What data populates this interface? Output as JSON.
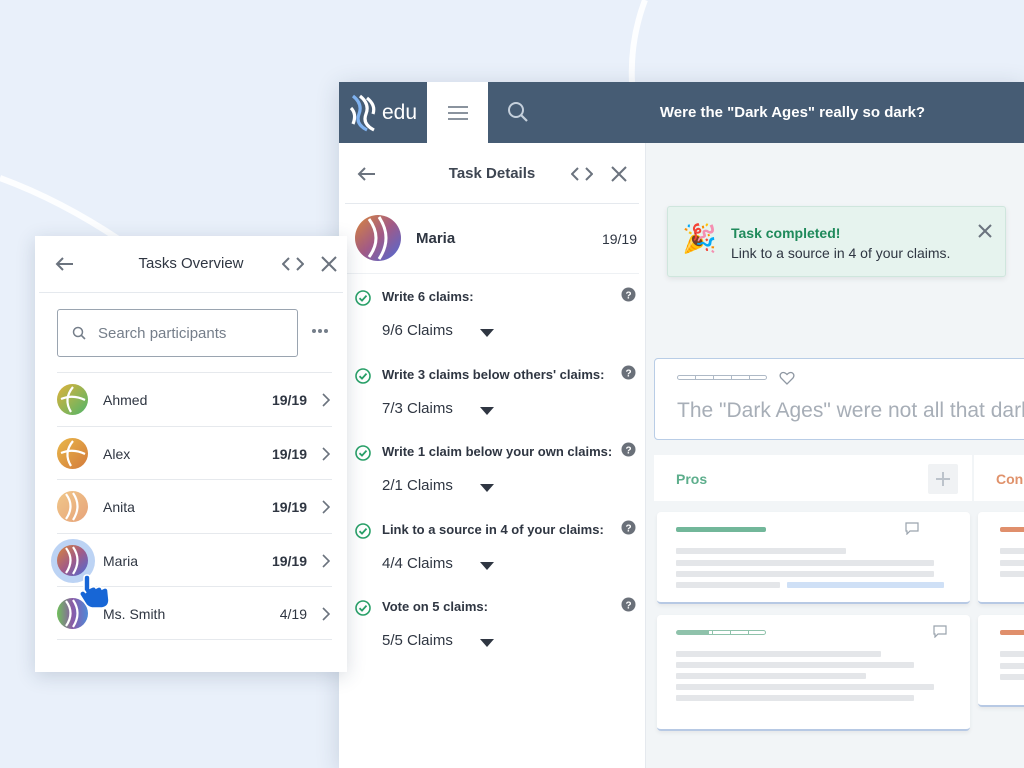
{
  "app": {
    "logo_text": "edu",
    "title": "Were the \"Dark Ages\" really so dark?"
  },
  "task_details": {
    "title": "Task Details",
    "user": {
      "name": "Maria",
      "score": "19/19"
    },
    "tasks": [
      {
        "label": "Write 6 claims:",
        "value": "9/6 Claims"
      },
      {
        "label": "Write 3 claims below others' claims:",
        "value": "7/3 Claims"
      },
      {
        "label": "Write 1 claim below your own claims:",
        "value": "2/1 Claims"
      },
      {
        "label": "Link to a source in 4 of your claims:",
        "value": "4/4 Claims"
      },
      {
        "label": "Vote on 5 claims:",
        "value": "5/5 Claims"
      }
    ]
  },
  "notification": {
    "title": "Task completed!",
    "body": "Link to a source in 4 of your claims."
  },
  "thesis": {
    "text": "The \"Dark Ages\" were not all that dark."
  },
  "columns": {
    "pros": "Pros",
    "cons": "Con"
  },
  "overview": {
    "title": "Tasks Overview",
    "search_placeholder": "Search participants",
    "participants": [
      {
        "name": "Ahmed",
        "score": "19/19",
        "bold": true
      },
      {
        "name": "Alex",
        "score": "19/19",
        "bold": true
      },
      {
        "name": "Anita",
        "score": "19/19",
        "bold": true
      },
      {
        "name": "Maria",
        "score": "19/19",
        "bold": true
      },
      {
        "name": "Ms. Smith",
        "score": "4/19",
        "bold": false
      }
    ]
  },
  "colors": {
    "topbar": "#465c74",
    "success": "#1f8a5b",
    "pros": "#5dae8c",
    "cons": "#e0926b",
    "accent": "#1766d6"
  }
}
